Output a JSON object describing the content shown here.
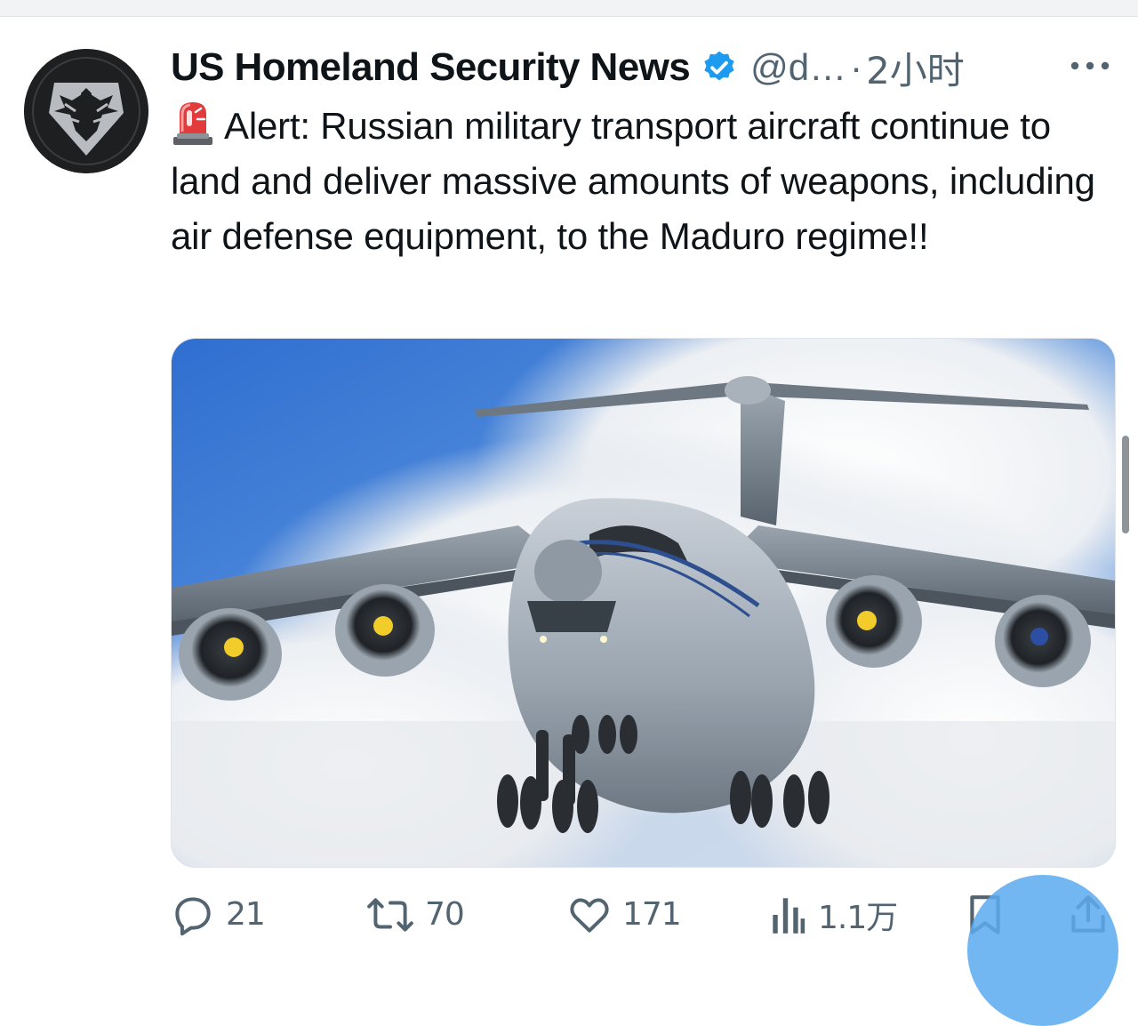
{
  "tweet": {
    "author_name": "US Homeland Security News",
    "handle": "@d…",
    "separator": "·",
    "time": "2小时",
    "text": "Alert: Russian military transport aircraft continue to land and deliver massive amounts of weapons, including air defense equipment, to the Maduro regime!!",
    "emoji_icon": "police-car-light-emoji"
  },
  "actions": {
    "reply_count": "21",
    "retweet_count": "70",
    "like_count": "171",
    "views_count": "1.1万"
  },
  "colors": {
    "accent": "#1d9bf0",
    "text_primary": "#0f1419",
    "text_secondary": "#536471"
  },
  "icons": {
    "avatar": "eagle-shield-logo",
    "verified": "verified-badge-icon",
    "more": "more-dots-icon",
    "reply": "reply-icon",
    "retweet": "retweet-icon",
    "like": "heart-icon",
    "views": "views-bar-chart-icon",
    "bookmark": "bookmark-icon",
    "share": "share-icon"
  }
}
